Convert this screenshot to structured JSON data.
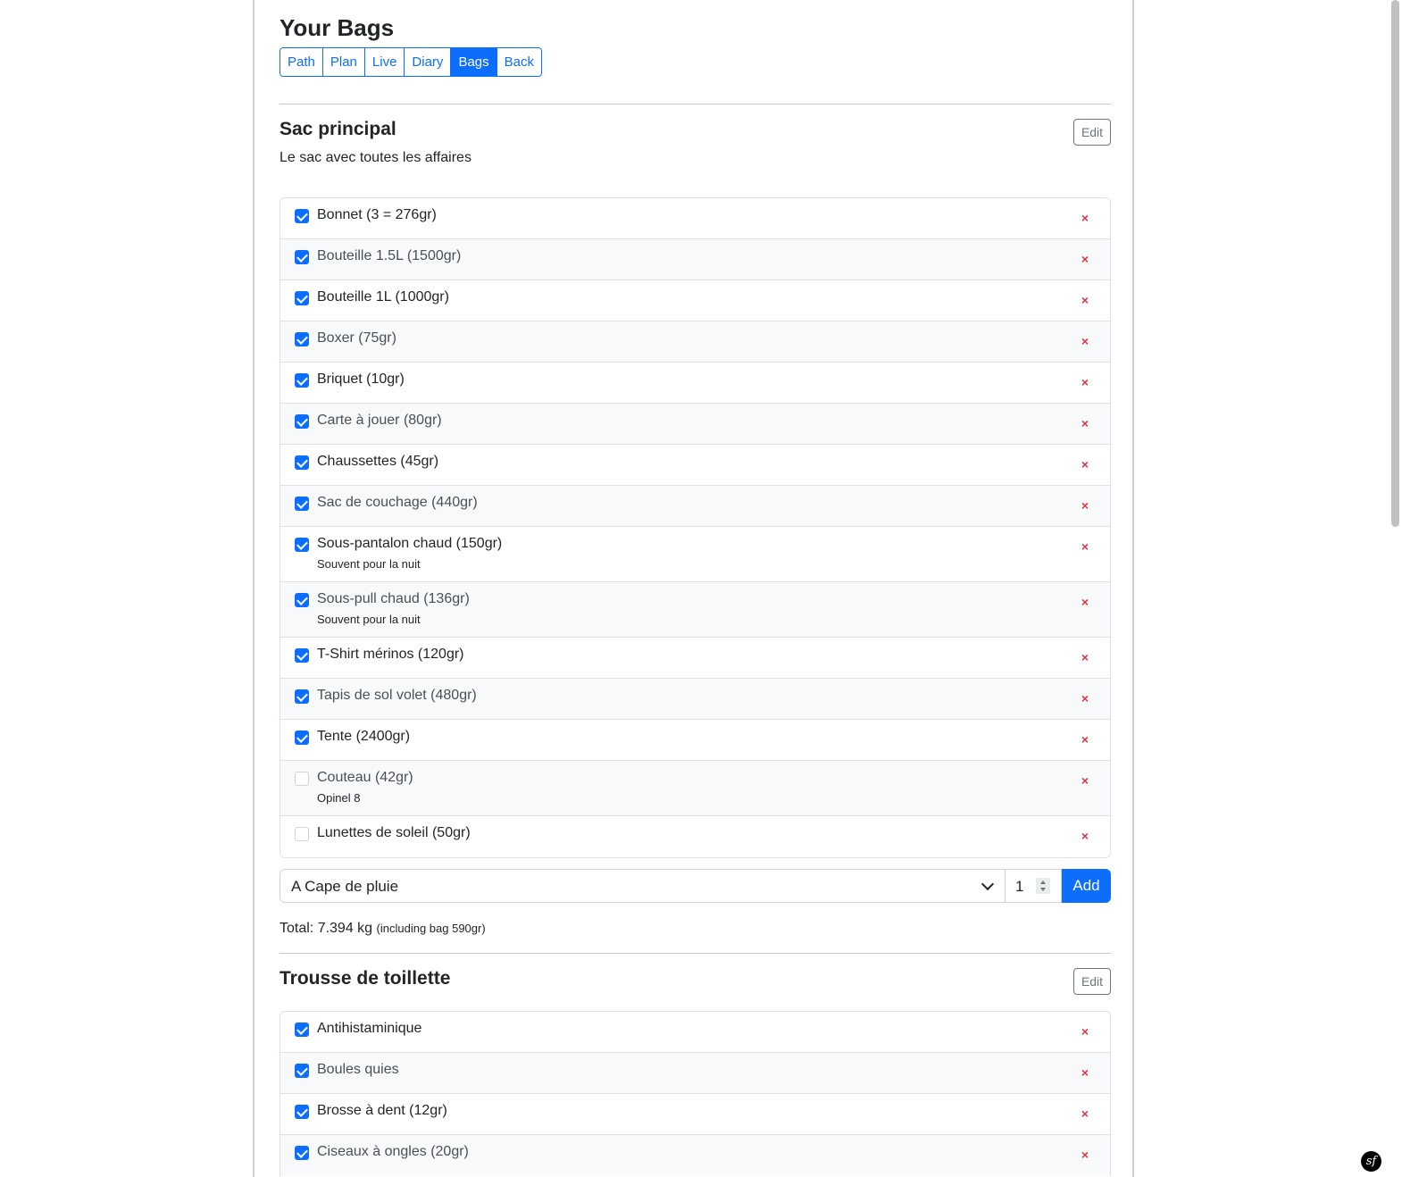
{
  "page_title": "Your Bags",
  "nav": [
    {
      "label": "Path",
      "active": false
    },
    {
      "label": "Plan",
      "active": false
    },
    {
      "label": "Live",
      "active": false
    },
    {
      "label": "Diary",
      "active": false
    },
    {
      "label": "Bags",
      "active": true
    },
    {
      "label": "Back",
      "active": false
    }
  ],
  "bag1": {
    "title": "Sac principal",
    "description": "Le sac avec toutes les affaires",
    "edit_label": "Edit",
    "remove_glyph": "×",
    "items": [
      {
        "label": "Bonnet (3 = 276gr)",
        "checked": true,
        "note": ""
      },
      {
        "label": "Bouteille 1.5L (1500gr)",
        "checked": true,
        "note": ""
      },
      {
        "label": "Bouteille 1L (1000gr)",
        "checked": true,
        "note": ""
      },
      {
        "label": "Boxer (75gr)",
        "checked": true,
        "note": ""
      },
      {
        "label": "Briquet (10gr)",
        "checked": true,
        "note": ""
      },
      {
        "label": "Carte à jouer (80gr)",
        "checked": true,
        "note": ""
      },
      {
        "label": "Chaussettes (45gr)",
        "checked": true,
        "note": ""
      },
      {
        "label": "Sac de couchage (440gr)",
        "checked": true,
        "note": ""
      },
      {
        "label": "Sous-pantalon chaud (150gr)",
        "checked": true,
        "note": "Souvent pour la nuit"
      },
      {
        "label": "Sous-pull chaud (136gr)",
        "checked": true,
        "note": "Souvent pour la nuit"
      },
      {
        "label": "T-Shirt mérinos (120gr)",
        "checked": true,
        "note": ""
      },
      {
        "label": "Tapis de sol volet (480gr)",
        "checked": true,
        "note": ""
      },
      {
        "label": "Tente (2400gr)",
        "checked": true,
        "note": ""
      },
      {
        "label": "Couteau (42gr)",
        "checked": false,
        "note": "Opinel 8"
      },
      {
        "label": "Lunettes de soleil (50gr)",
        "checked": false,
        "note": ""
      }
    ],
    "add": {
      "selected": "A Cape de pluie",
      "quantity": "1",
      "button_label": "Add"
    },
    "total_label": "Total: 7.394 kg",
    "total_detail": "(including bag 590gr)"
  },
  "bag2": {
    "title": "Trousse de toillette",
    "edit_label": "Edit",
    "items": [
      {
        "label": "Antihistaminique",
        "checked": true,
        "note": ""
      },
      {
        "label": "Boules quies",
        "checked": true,
        "note": ""
      },
      {
        "label": "Brosse à dent (12gr)",
        "checked": true,
        "note": ""
      },
      {
        "label": "Ciseaux à ongles (20gr)",
        "checked": true,
        "note": ""
      }
    ]
  },
  "symfony_icon_text": "sf",
  "colors": {
    "primary": "#0d6efd",
    "danger": "#dc3545",
    "border": "#dee2e6",
    "stripe": "#f8f9fa"
  }
}
